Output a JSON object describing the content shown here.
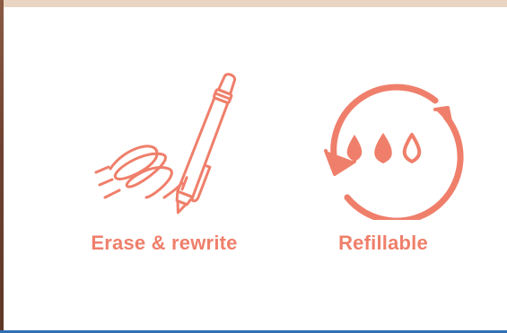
{
  "colors": {
    "accent": "#ef7f6b",
    "top_band": "#ead5c2",
    "bottom_line": "#2e6fb6",
    "background": "#ffffff"
  },
  "features": [
    {
      "icon": "pen-erase-icon",
      "label": "Erase & rewrite"
    },
    {
      "icon": "refill-cycle-icon",
      "label": "Refillable"
    }
  ]
}
